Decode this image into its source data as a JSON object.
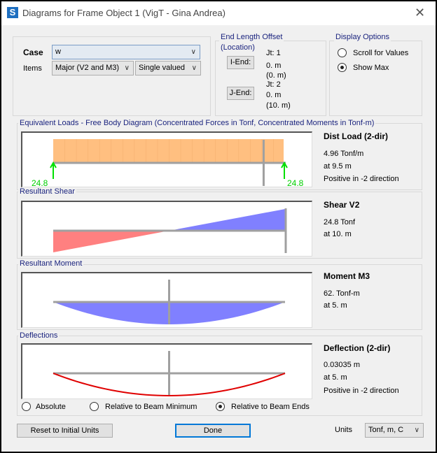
{
  "window": {
    "title": "Diagrams for Frame Object 1  (VigT - Gina Andrea)",
    "icon_letter": "S"
  },
  "case": {
    "label": "Case",
    "value": "w"
  },
  "items": {
    "label": "Items",
    "component": "Major (V2 and M3)",
    "valuing": "Single valued"
  },
  "end_offset": {
    "title1": "End Length Offset",
    "title2": "(Location)",
    "i_end": {
      "button": "I-End:",
      "jt": "Jt:  1",
      "offset": "0. m",
      "location": "(0. m)"
    },
    "j_end": {
      "button": "J-End:",
      "jt": "Jt:  2",
      "offset": "0. m",
      "location": "(10. m)"
    }
  },
  "display_options": {
    "title": "Display Options",
    "options": [
      {
        "label": "Scroll for Values",
        "selected": false
      },
      {
        "label": "Show Max",
        "selected": true
      }
    ]
  },
  "span_length": 10,
  "loads": {
    "title": "Equivalent Loads - Free Body Diagram  (Concentrated Forces in Tonf, Concentrated Moments in Tonf-m)",
    "heading": "Dist Load (2-dir)",
    "value": "4.96 Tonf/m",
    "location": "at 9.5 m",
    "note": "Positive in -2 direction",
    "reaction_left": "24.8",
    "reaction_right": "24.8",
    "color": "#ffbf80",
    "marker_at": 9.5
  },
  "shear": {
    "title": "Resultant Shear",
    "heading": "Shear V2",
    "value": "24.8 Tonf",
    "location": "at 10. m",
    "max": 24.8,
    "neg_color": "#ff8080",
    "pos_color": "#8080ff",
    "marker_at": 10
  },
  "moment": {
    "title": "Resultant Moment",
    "heading": "Moment M3",
    "value": "62. Tonf-m",
    "location": "at 5. m",
    "max": 62,
    "color": "#8080ff",
    "marker_at": 5
  },
  "deflection": {
    "title": "Deflections",
    "heading": "Deflection (2-dir)",
    "value": "0.03035 m",
    "location": "at 5. m",
    "note": "Positive in -2 direction",
    "max": 0.03035,
    "color": "#e00000",
    "marker_at": 5,
    "modes": [
      {
        "label": "Absolute",
        "selected": false
      },
      {
        "label": "Relative to Beam Minimum",
        "selected": false
      },
      {
        "label": "Relative to Beam Ends",
        "selected": true
      }
    ]
  },
  "footer": {
    "reset": "Reset to Initial Units",
    "done": "Done",
    "units_label": "Units",
    "units_value": "Tonf, m, C"
  }
}
